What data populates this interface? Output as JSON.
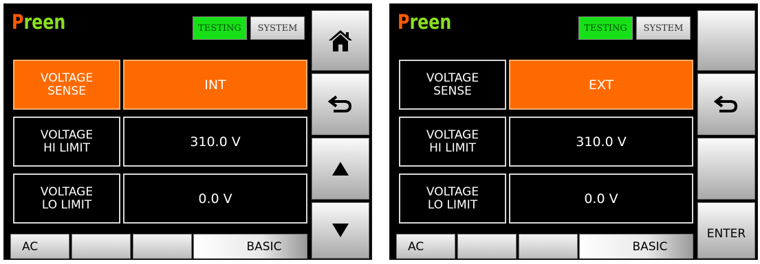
{
  "screens": [
    {
      "brand": {
        "first": "P",
        "rest": "reen"
      },
      "mode_tabs": {
        "testing": "TESTING",
        "system": "SYSTEM"
      },
      "rows": [
        {
          "label": "VOLTAGE\nSENSE",
          "value": "INT"
        },
        {
          "label": "VOLTAGE\nHI LIMIT",
          "value": "310.0 V"
        },
        {
          "label": "VOLTAGE\nLO LIMIT",
          "value": "0.0 V"
        }
      ],
      "bottom_tabs": [
        "AC",
        "",
        "",
        "BASIC"
      ],
      "side_buttons": [
        "home-icon",
        "back-icon",
        "up-arrow-icon",
        "down-arrow-icon"
      ]
    },
    {
      "brand": {
        "first": "P",
        "rest": "reen"
      },
      "mode_tabs": {
        "testing": "TESTING",
        "system": "SYSTEM"
      },
      "rows": [
        {
          "label": "VOLTAGE\nSENSE",
          "value": "EXT"
        },
        {
          "label": "VOLTAGE\nHI LIMIT",
          "value": "310.0 V"
        },
        {
          "label": "VOLTAGE\nLO LIMIT",
          "value": "0.0 V"
        }
      ],
      "bottom_tabs": [
        "AC",
        "",
        "",
        "BASIC"
      ],
      "side_buttons": [
        "",
        "back-icon",
        "",
        "ENTER"
      ]
    }
  ],
  "colors": {
    "accent": "#ff6a00",
    "testing_active": "#18e018",
    "brand_p": "#ff5a00",
    "brand_rest": "#8adf20"
  }
}
